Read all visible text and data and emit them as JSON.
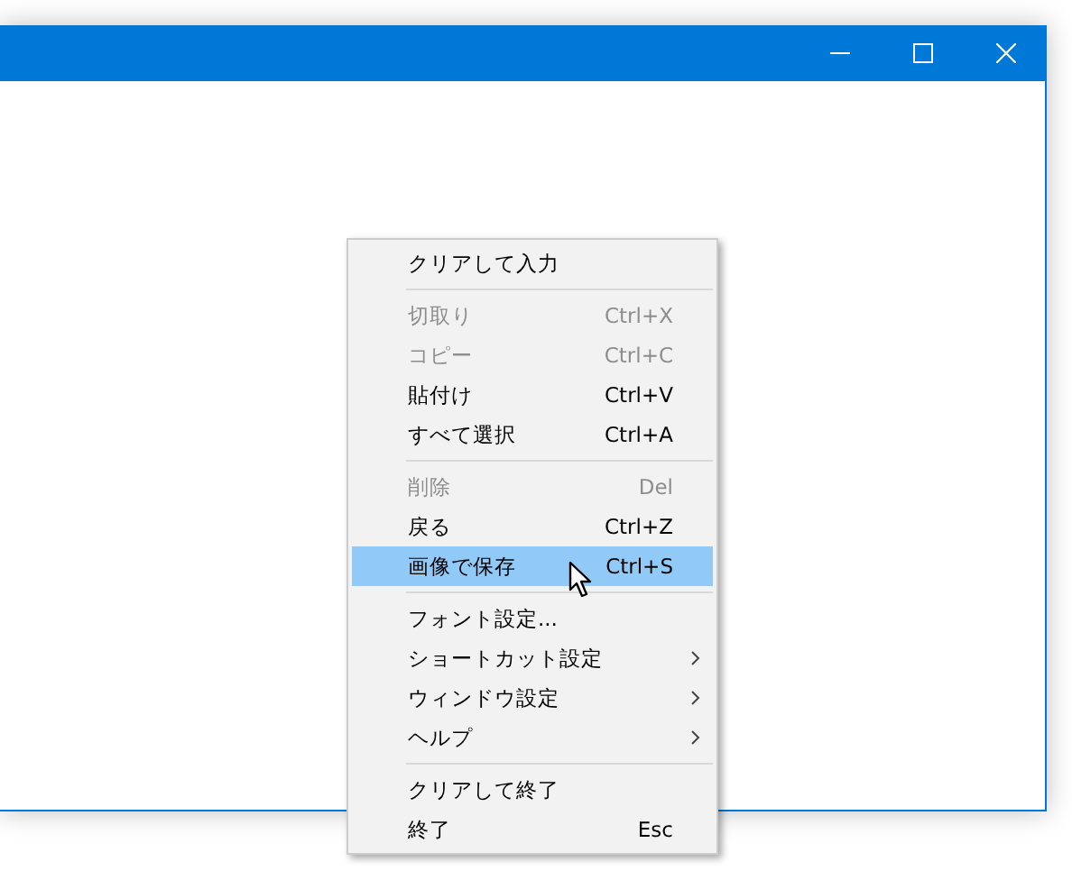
{
  "context_menu": {
    "groups": [
      [
        {
          "label": "クリアして入力",
          "disabled": false,
          "selected": false,
          "submenu": false
        }
      ],
      [
        {
          "label": "切取り",
          "shortcut": "Ctrl+X",
          "disabled": true,
          "selected": false,
          "submenu": false
        },
        {
          "label": "コピー",
          "shortcut": "Ctrl+C",
          "disabled": true,
          "selected": false,
          "submenu": false
        },
        {
          "label": "貼付け",
          "shortcut": "Ctrl+V",
          "disabled": false,
          "selected": false,
          "submenu": false
        },
        {
          "label": "すべて選択",
          "shortcut": "Ctrl+A",
          "disabled": false,
          "selected": false,
          "submenu": false
        }
      ],
      [
        {
          "label": "削除",
          "shortcut": "Del",
          "disabled": true,
          "selected": false,
          "submenu": false
        },
        {
          "label": "戻る",
          "shortcut": "Ctrl+Z",
          "disabled": false,
          "selected": false,
          "submenu": false
        },
        {
          "label": "画像で保存",
          "shortcut": "Ctrl+S",
          "disabled": false,
          "selected": true,
          "submenu": false
        }
      ],
      [
        {
          "label": "フォント設定...",
          "disabled": false,
          "selected": false,
          "submenu": false
        },
        {
          "label": "ショートカット設定",
          "disabled": false,
          "selected": false,
          "submenu": true
        },
        {
          "label": "ウィンドウ設定",
          "disabled": false,
          "selected": false,
          "submenu": true
        },
        {
          "label": "ヘルプ",
          "disabled": false,
          "selected": false,
          "submenu": true
        }
      ],
      [
        {
          "label": "クリアして終了",
          "disabled": false,
          "selected": false,
          "submenu": false
        },
        {
          "label": "終了",
          "shortcut": "Esc",
          "disabled": false,
          "selected": false,
          "submenu": false
        }
      ]
    ]
  }
}
